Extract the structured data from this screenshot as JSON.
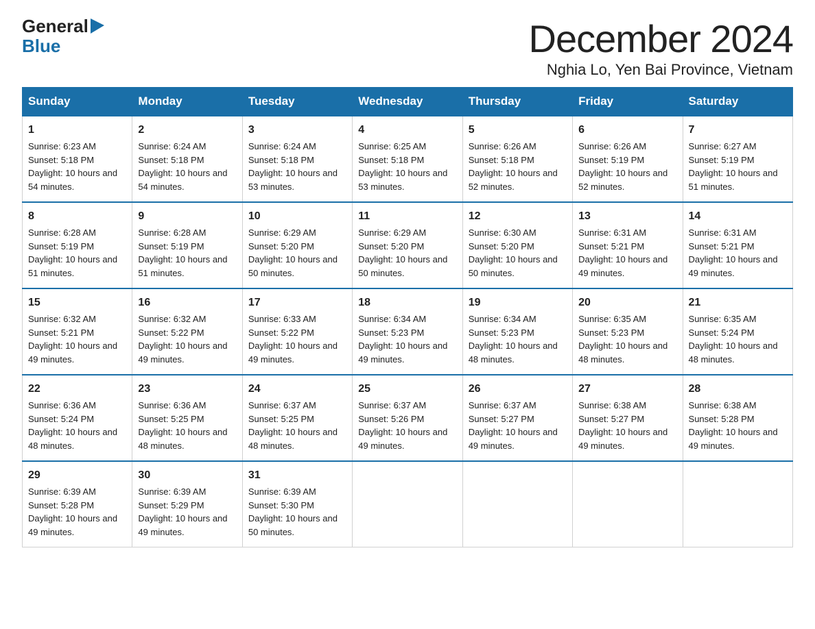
{
  "header": {
    "logo_general": "General",
    "logo_blue": "Blue",
    "month_title": "December 2024",
    "location": "Nghia Lo, Yen Bai Province, Vietnam"
  },
  "days_of_week": [
    "Sunday",
    "Monday",
    "Tuesday",
    "Wednesday",
    "Thursday",
    "Friday",
    "Saturday"
  ],
  "weeks": [
    [
      {
        "day": "1",
        "sunrise": "6:23 AM",
        "sunset": "5:18 PM",
        "daylight": "10 hours and 54 minutes."
      },
      {
        "day": "2",
        "sunrise": "6:24 AM",
        "sunset": "5:18 PM",
        "daylight": "10 hours and 54 minutes."
      },
      {
        "day": "3",
        "sunrise": "6:24 AM",
        "sunset": "5:18 PM",
        "daylight": "10 hours and 53 minutes."
      },
      {
        "day": "4",
        "sunrise": "6:25 AM",
        "sunset": "5:18 PM",
        "daylight": "10 hours and 53 minutes."
      },
      {
        "day": "5",
        "sunrise": "6:26 AM",
        "sunset": "5:18 PM",
        "daylight": "10 hours and 52 minutes."
      },
      {
        "day": "6",
        "sunrise": "6:26 AM",
        "sunset": "5:19 PM",
        "daylight": "10 hours and 52 minutes."
      },
      {
        "day": "7",
        "sunrise": "6:27 AM",
        "sunset": "5:19 PM",
        "daylight": "10 hours and 51 minutes."
      }
    ],
    [
      {
        "day": "8",
        "sunrise": "6:28 AM",
        "sunset": "5:19 PM",
        "daylight": "10 hours and 51 minutes."
      },
      {
        "day": "9",
        "sunrise": "6:28 AM",
        "sunset": "5:19 PM",
        "daylight": "10 hours and 51 minutes."
      },
      {
        "day": "10",
        "sunrise": "6:29 AM",
        "sunset": "5:20 PM",
        "daylight": "10 hours and 50 minutes."
      },
      {
        "day": "11",
        "sunrise": "6:29 AM",
        "sunset": "5:20 PM",
        "daylight": "10 hours and 50 minutes."
      },
      {
        "day": "12",
        "sunrise": "6:30 AM",
        "sunset": "5:20 PM",
        "daylight": "10 hours and 50 minutes."
      },
      {
        "day": "13",
        "sunrise": "6:31 AM",
        "sunset": "5:21 PM",
        "daylight": "10 hours and 49 minutes."
      },
      {
        "day": "14",
        "sunrise": "6:31 AM",
        "sunset": "5:21 PM",
        "daylight": "10 hours and 49 minutes."
      }
    ],
    [
      {
        "day": "15",
        "sunrise": "6:32 AM",
        "sunset": "5:21 PM",
        "daylight": "10 hours and 49 minutes."
      },
      {
        "day": "16",
        "sunrise": "6:32 AM",
        "sunset": "5:22 PM",
        "daylight": "10 hours and 49 minutes."
      },
      {
        "day": "17",
        "sunrise": "6:33 AM",
        "sunset": "5:22 PM",
        "daylight": "10 hours and 49 minutes."
      },
      {
        "day": "18",
        "sunrise": "6:34 AM",
        "sunset": "5:23 PM",
        "daylight": "10 hours and 49 minutes."
      },
      {
        "day": "19",
        "sunrise": "6:34 AM",
        "sunset": "5:23 PM",
        "daylight": "10 hours and 48 minutes."
      },
      {
        "day": "20",
        "sunrise": "6:35 AM",
        "sunset": "5:23 PM",
        "daylight": "10 hours and 48 minutes."
      },
      {
        "day": "21",
        "sunrise": "6:35 AM",
        "sunset": "5:24 PM",
        "daylight": "10 hours and 48 minutes."
      }
    ],
    [
      {
        "day": "22",
        "sunrise": "6:36 AM",
        "sunset": "5:24 PM",
        "daylight": "10 hours and 48 minutes."
      },
      {
        "day": "23",
        "sunrise": "6:36 AM",
        "sunset": "5:25 PM",
        "daylight": "10 hours and 48 minutes."
      },
      {
        "day": "24",
        "sunrise": "6:37 AM",
        "sunset": "5:25 PM",
        "daylight": "10 hours and 48 minutes."
      },
      {
        "day": "25",
        "sunrise": "6:37 AM",
        "sunset": "5:26 PM",
        "daylight": "10 hours and 49 minutes."
      },
      {
        "day": "26",
        "sunrise": "6:37 AM",
        "sunset": "5:27 PM",
        "daylight": "10 hours and 49 minutes."
      },
      {
        "day": "27",
        "sunrise": "6:38 AM",
        "sunset": "5:27 PM",
        "daylight": "10 hours and 49 minutes."
      },
      {
        "day": "28",
        "sunrise": "6:38 AM",
        "sunset": "5:28 PM",
        "daylight": "10 hours and 49 minutes."
      }
    ],
    [
      {
        "day": "29",
        "sunrise": "6:39 AM",
        "sunset": "5:28 PM",
        "daylight": "10 hours and 49 minutes."
      },
      {
        "day": "30",
        "sunrise": "6:39 AM",
        "sunset": "5:29 PM",
        "daylight": "10 hours and 49 minutes."
      },
      {
        "day": "31",
        "sunrise": "6:39 AM",
        "sunset": "5:30 PM",
        "daylight": "10 hours and 50 minutes."
      },
      null,
      null,
      null,
      null
    ]
  ]
}
